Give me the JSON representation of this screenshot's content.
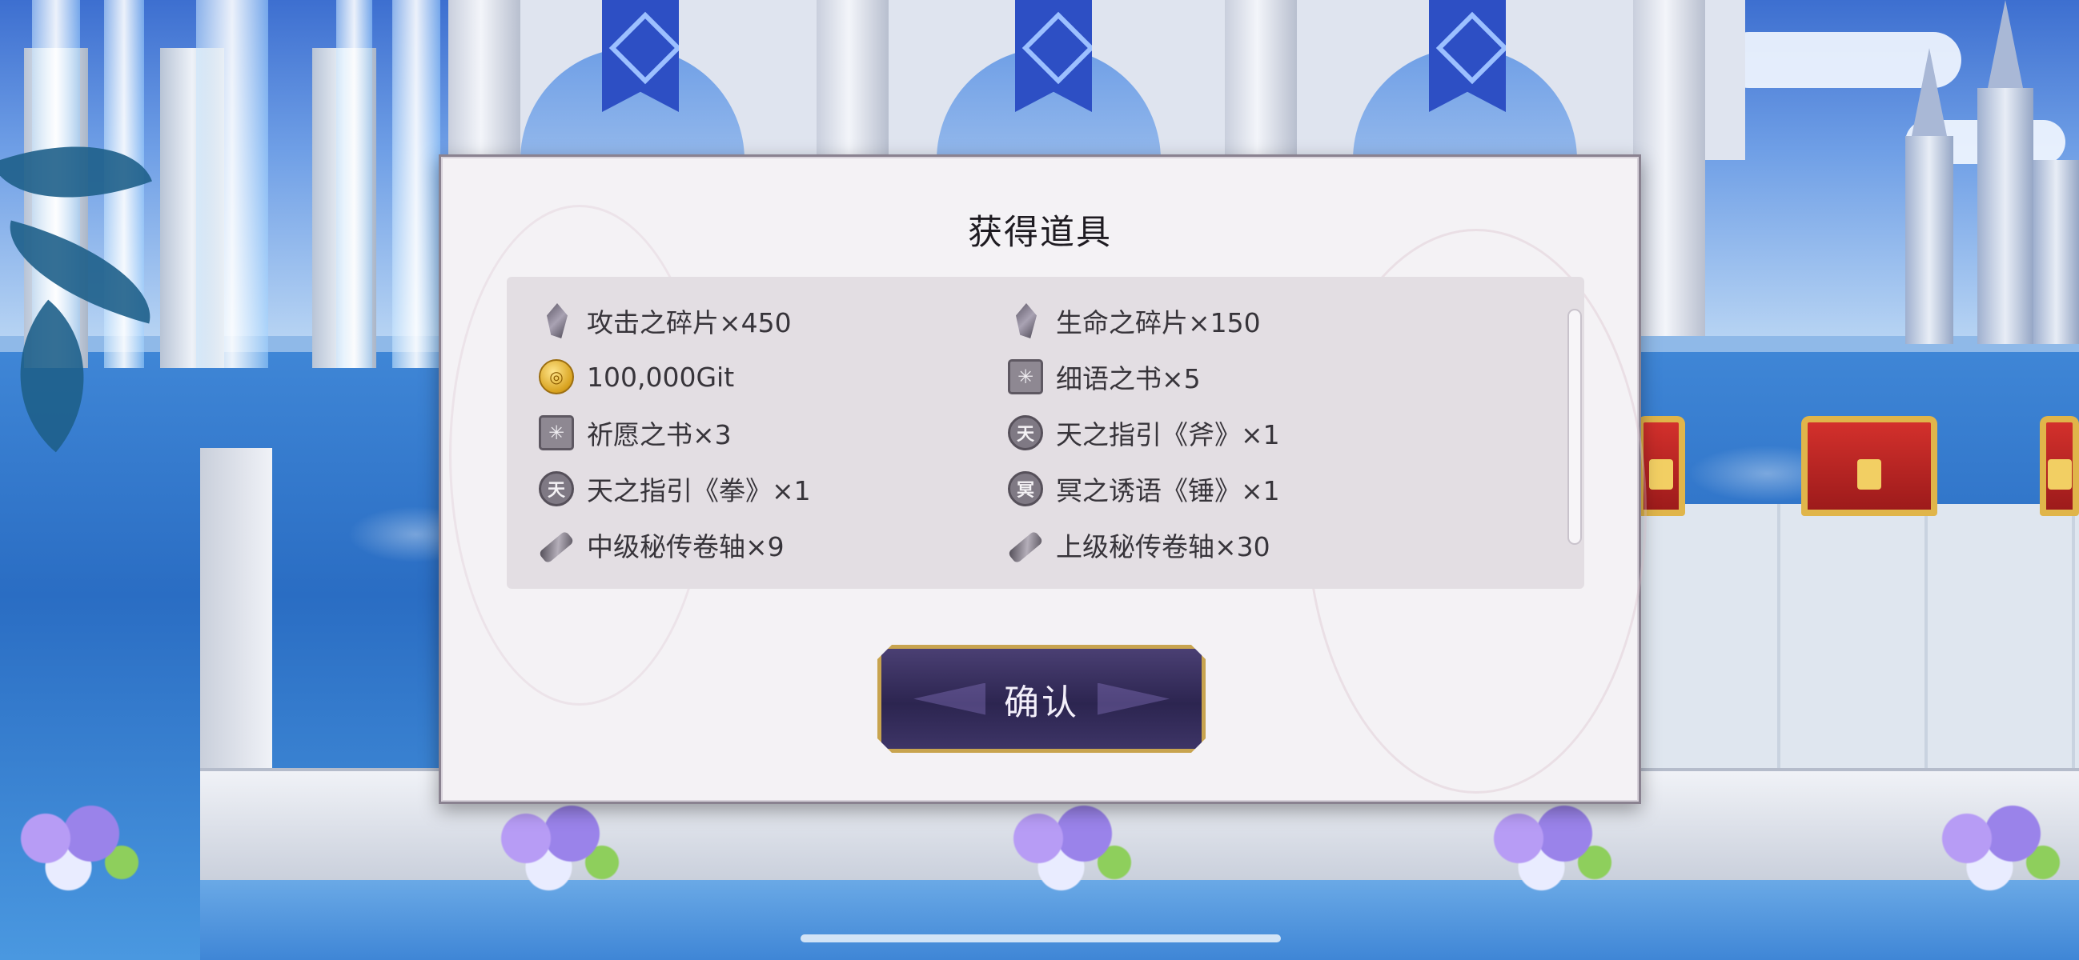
{
  "dialog": {
    "title": "获得道具",
    "confirm_label": "确认"
  },
  "items": [
    {
      "icon": "crystal-shard-icon",
      "label": "攻击之碎片×450"
    },
    {
      "icon": "crystal-shard-icon",
      "label": "生命之碎片×150"
    },
    {
      "icon": "gold-coin-icon",
      "label": "100,000Git"
    },
    {
      "icon": "book-icon",
      "label": "细语之书×5"
    },
    {
      "icon": "book-icon",
      "label": "祈愿之书×3"
    },
    {
      "icon": "seal-icon",
      "label": "天之指引《斧》×1"
    },
    {
      "icon": "seal-icon",
      "label": "天之指引《拳》×1"
    },
    {
      "icon": "seal-icon",
      "label": "冥之诱语《锤》×1"
    },
    {
      "icon": "scroll-icon",
      "label": "中级秘传卷轴×9"
    },
    {
      "icon": "scroll-icon",
      "label": "上级秘传卷轴×30"
    }
  ],
  "icon_glyphs": {
    "coin": "◎",
    "book": "✳",
    "seal_heaven": "天",
    "seal_underworld": "冥"
  },
  "colors": {
    "dialog_bg": "#f4f2f5",
    "panel_bg": "#e3dee3",
    "button_bg": "#2c2550",
    "button_border": "#c8a44f"
  }
}
